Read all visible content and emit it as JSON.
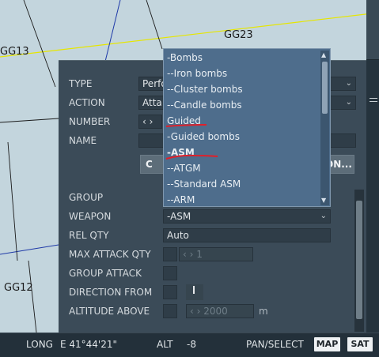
{
  "map": {
    "labels": {
      "gg13": "GG13",
      "gg23": "GG23",
      "gg12": "GG12"
    }
  },
  "form": {
    "type": {
      "label": "TYPE",
      "value": "Perfo"
    },
    "action": {
      "label": "ACTION",
      "value": "Atta"
    },
    "number": {
      "label": "NUMBER",
      "value": "‹ ›"
    },
    "name": {
      "label": "NAME",
      "value": ""
    },
    "button_left_fragment": "C",
    "button_right_fragment": "ON...",
    "group": {
      "label": "GROUP"
    },
    "weapon": {
      "label": "WEAPON",
      "value": "-ASM"
    },
    "rel_qty": {
      "label": "REL QTY",
      "value": "Auto"
    },
    "max_attack_qty": {
      "label": "MAX ATTACK QTY",
      "value": "‹ › 1"
    },
    "group_attack": {
      "label": "GROUP ATTACK"
    },
    "direction_from": {
      "label": "DIRECTION FROM"
    },
    "altitude_above": {
      "label": "ALTITUDE ABOVE",
      "value": "‹ › 2000",
      "unit": "m"
    }
  },
  "dropdown": {
    "options": [
      "-Bombs",
      "--Iron bombs",
      "--Cluster bombs",
      "--Candle bombs",
      "Guided",
      "-Guided bombs",
      "-ASM",
      "--ATGM",
      "--Standard ASM",
      "--ARM"
    ],
    "selected": "-ASM",
    "annotation_color": "#e0202a"
  },
  "status": {
    "long_label": "LONG",
    "long_value": "E 41°44'21\"",
    "alt_label": "ALT",
    "alt_value": "-8",
    "mode": "PAN/SELECT",
    "map_button": "MAP",
    "sat_button": "SAT"
  }
}
